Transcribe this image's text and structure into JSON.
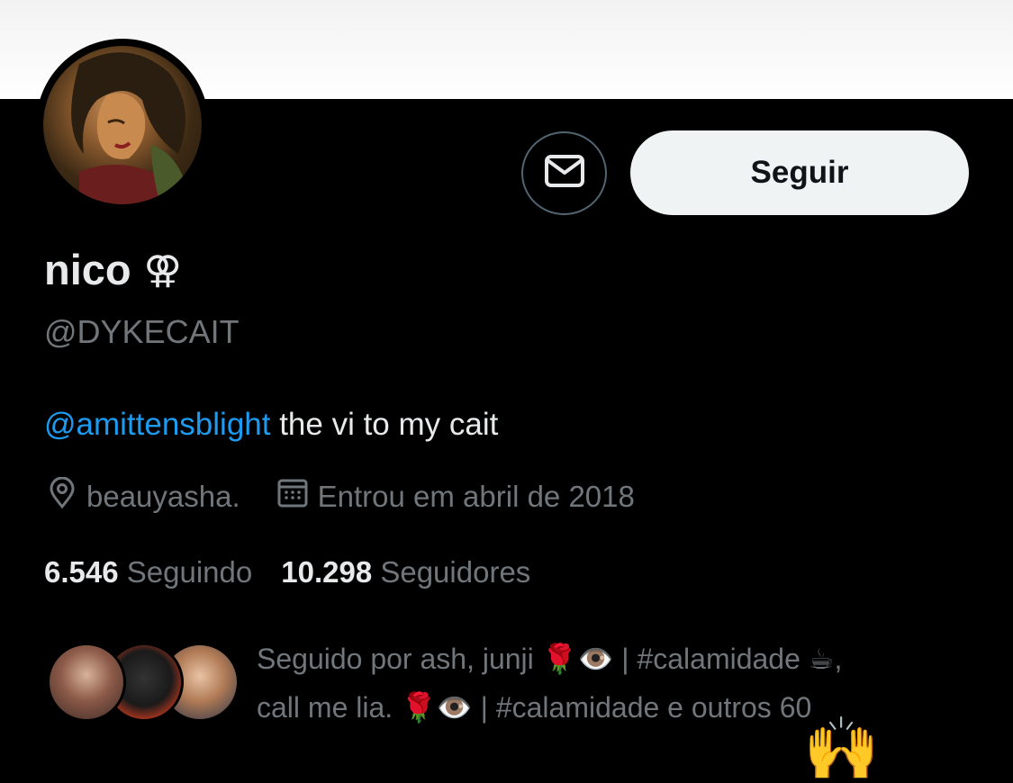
{
  "profile": {
    "name": "nico",
    "name_symbol": "⚢",
    "handle": "@DYKECAIT",
    "bio_mention": "@amittensblight",
    "bio_text": " the vi to my cait",
    "location": "beauyasha.",
    "joined": "Entrou em abril de 2018"
  },
  "actions": {
    "follow_label": "Seguir",
    "message_icon": "envelope-icon"
  },
  "stats": {
    "following_count": "6.546",
    "following_label": "Seguindo",
    "followers_count": "10.298",
    "followers_label": "Seguidores"
  },
  "followed_by": {
    "line1": "Seguido por ash, junji 🌹👁️ | #calamidade ☕,",
    "line2": "call me lia. 🌹👁️ | #calamidade e outros 60"
  },
  "decor": {
    "hands_emoji": "🙌"
  },
  "colors": {
    "background": "#000000",
    "primary_text": "#e7e9ea",
    "secondary_text": "#71767b",
    "accent": "#1d9bf0",
    "button_bg": "#eff3f4"
  }
}
